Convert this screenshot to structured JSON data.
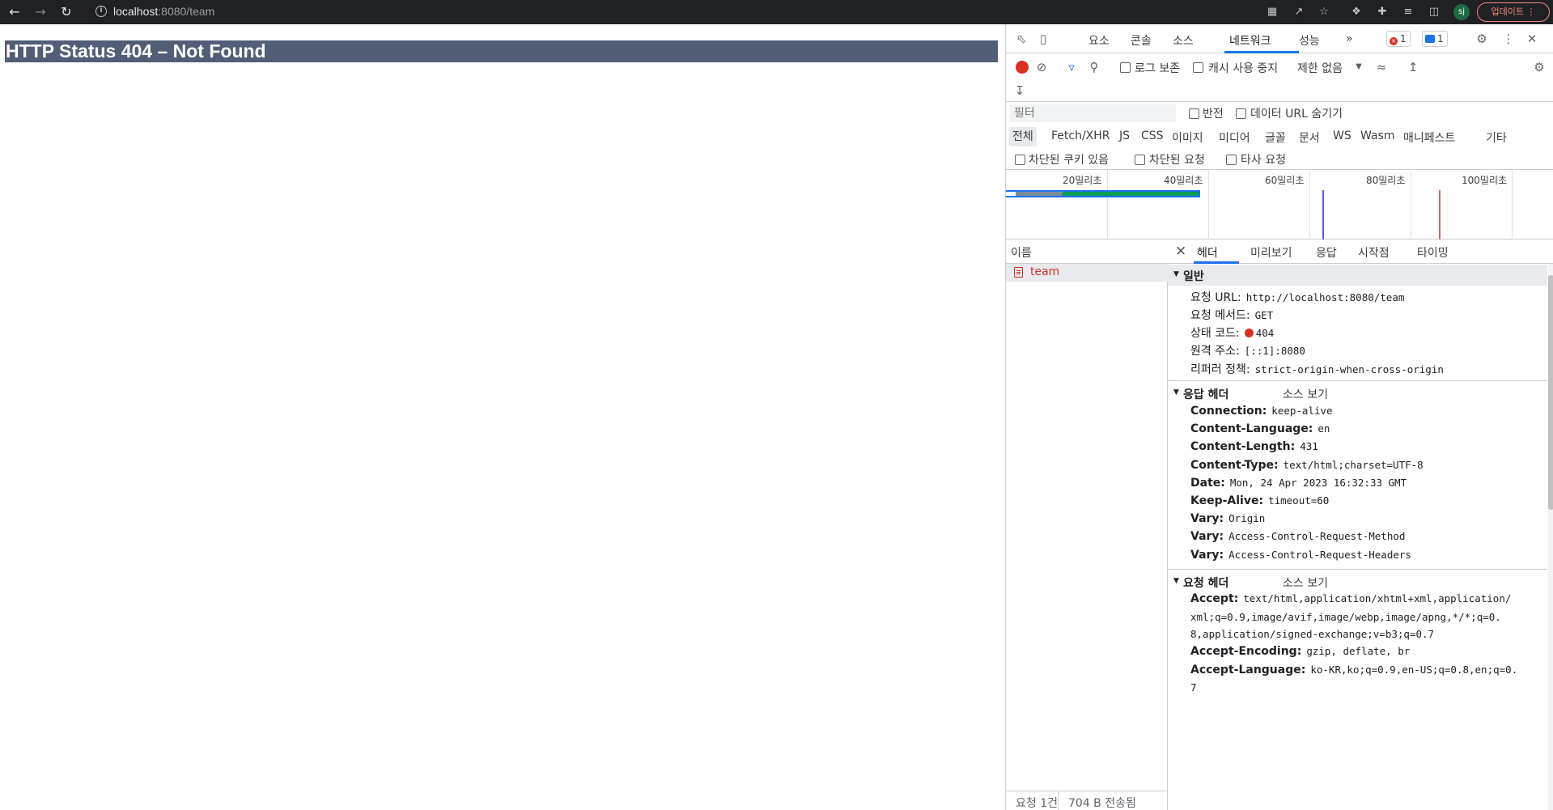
{
  "browser": {
    "url_host": "localhost",
    "url_rest": ":8080/team",
    "avatar": "sj",
    "update_label": "업데이트"
  },
  "page": {
    "error_title": "HTTP Status 404 – Not Found"
  },
  "devtools": {
    "tabs": [
      "요소",
      "콘솔",
      "소스",
      "네트워크",
      "성능"
    ],
    "more": "»",
    "error_count": "1",
    "message_count": "1",
    "toolbar": {
      "preserve_log": "로그 보존",
      "disable_cache": "캐시 사용 중지",
      "throttle": "제한 없음"
    },
    "filter": {
      "placeholder": "필터",
      "invert": "반전",
      "hide_data_urls": "데이터 URL 숨기기"
    },
    "types": [
      "전체",
      "Fetch/XHR",
      "JS",
      "CSS",
      "이미지",
      "미디어",
      "글꼴",
      "문서",
      "WS",
      "Wasm",
      "매니페스트",
      "기타"
    ],
    "blocked": {
      "blocked_cookies": "차단된 쿠키 있음",
      "blocked_requests": "차단된 요청",
      "third_party": "타사 요청"
    },
    "overview": {
      "ticks": [
        "20밀리초",
        "40밀리초",
        "60밀리초",
        "80밀리초",
        "100밀리초"
      ]
    },
    "list": {
      "header": "이름",
      "row_name": "team",
      "footer_requests": "요청 1건",
      "footer_transferred": "704 B 전송됨"
    },
    "detail": {
      "close": "×",
      "tabs": [
        "헤더",
        "미리보기",
        "응답",
        "시작점",
        "타이밍"
      ],
      "general": {
        "title": "일반",
        "request_url_k": "요청 URL:",
        "request_url_v": "http://localhost:8080/team",
        "method_k": "요청 메서드:",
        "method_v": "GET",
        "status_k": "상태 코드:",
        "status_v": "404",
        "remote_k": "원격 주소:",
        "remote_v": "[::1]:8080",
        "referrer_k": "리퍼러 정책:",
        "referrer_v": "strict-origin-when-cross-origin"
      },
      "response_headers": {
        "title": "응답 헤더",
        "view_source": "소스 보기",
        "rows": [
          {
            "k": "Connection:",
            "v": "keep-alive"
          },
          {
            "k": "Content-Language:",
            "v": "en"
          },
          {
            "k": "Content-Length:",
            "v": "431"
          },
          {
            "k": "Content-Type:",
            "v": "text/html;charset=UTF-8"
          },
          {
            "k": "Date:",
            "v": "Mon, 24 Apr 2023 16:32:33 GMT"
          },
          {
            "k": "Keep-Alive:",
            "v": "timeout=60"
          },
          {
            "k": "Vary:",
            "v": "Origin"
          },
          {
            "k": "Vary:",
            "v": "Access-Control-Request-Method"
          },
          {
            "k": "Vary:",
            "v": "Access-Control-Request-Headers"
          }
        ]
      },
      "request_headers": {
        "title": "요청 헤더",
        "view_source": "소스 보기",
        "accept_k": "Accept:",
        "accept_v1": "text/html,application/xhtml+xml,application/",
        "accept_v2": "xml;q=0.9,image/avif,image/webp,image/apng,*/*;q=0.",
        "accept_v3": "8,application/signed-exchange;v=b3;q=0.7",
        "encoding_k": "Accept-Encoding:",
        "encoding_v": "gzip, deflate, br",
        "language_k": "Accept-Language:",
        "language_v": "ko-KR,ko;q=0.9,en-US;q=0.8,en;q=0.",
        "language_v2": "7"
      }
    }
  }
}
